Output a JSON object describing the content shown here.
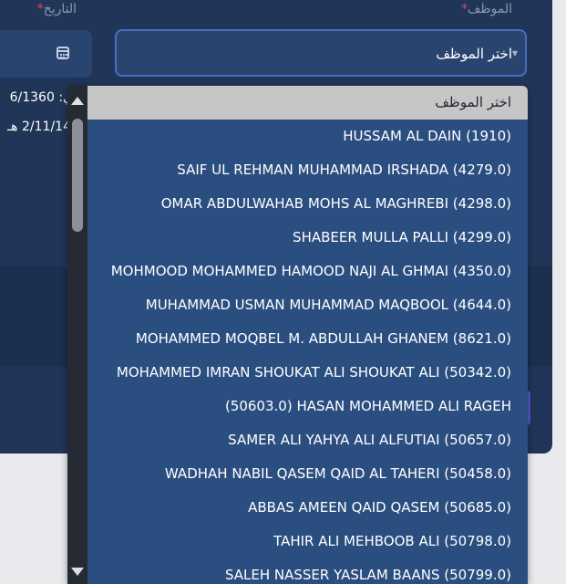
{
  "form": {
    "employee_label": "الموظف",
    "date_label": "التاريخ",
    "required_mark": "*",
    "employee_select_value": "اختر الموظف",
    "date_line_1": "ي: 6/1360",
    "date_line_2": "2/11/14 هـ"
  },
  "dropdown": {
    "options": [
      "اختر الموظف",
      "HUSSAM AL DAIN (1910)",
      "SAIF UL REHMAN MUHAMMAD IRSHADA (4279.0)",
      "OMAR ABDULWAHAB MOHS AL MAGHREBI (4298.0)",
      "SHABEER MULLA PALLI (4299.0)",
      "MOHMOOD MOHAMMED HAMOOD NAJI AL GHMAI (4350.0)",
      "MUHAMMAD USMAN MUHAMMAD MAQBOOL (4644.0)",
      "MOHAMMED MOQBEL M. ABDULLAH GHANEM (8621.0)",
      "MOHAMMED IMRAN SHOUKAT ALI SHOUKAT ALI (50342.0)",
      "(50603.0) HASAN MOHAMMED ALI RAGEH",
      "SAMER ALI YAHYA ALI ALFUTIAI (50657.0)",
      "WADHAH NABIL QASEM QAID AL TAHERI (50458.0)",
      "ABBAS AMEEN QAID QASEM (50685.0)",
      "TAHIR ALI MEHBOOB ALI (50798.0)",
      "SALEH NASSER YASLAM BAANS (50799.0)"
    ]
  },
  "colors": {
    "panel": "#203558",
    "dropdown": "#2b4e80",
    "placeholder_highlight": "#c6c6c6",
    "focus_border": "#4d6cc0",
    "required": "#e0475a"
  },
  "icons": {
    "calendar": "calendar-icon",
    "caret": "chevron-down-icon"
  }
}
